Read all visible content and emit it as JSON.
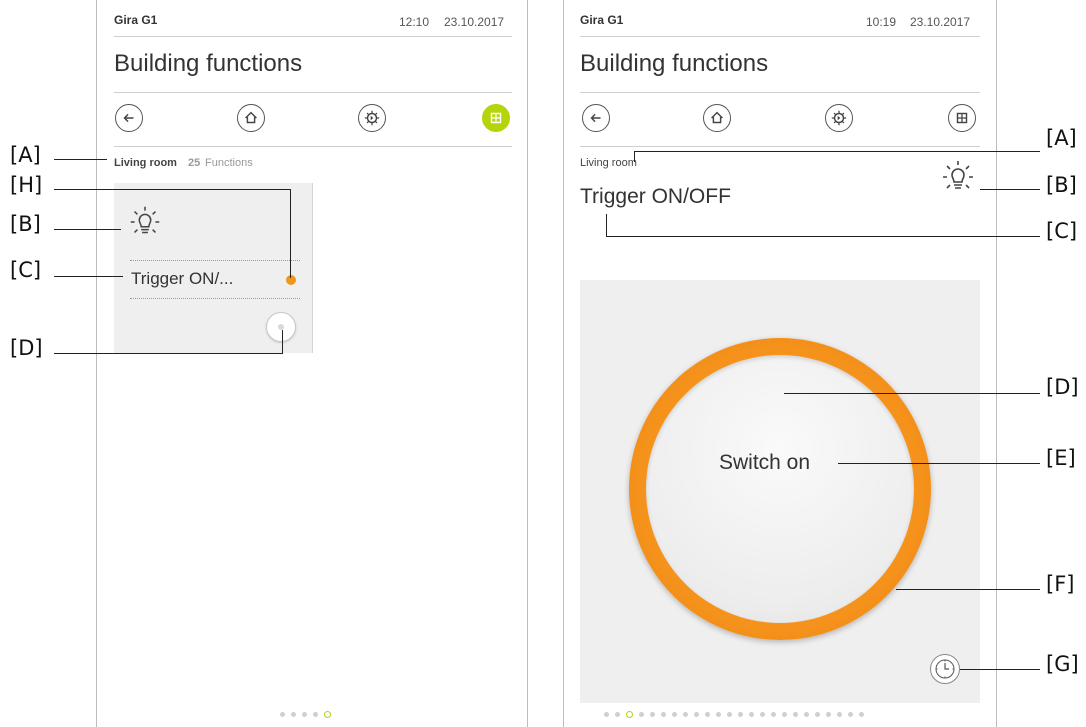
{
  "left": {
    "app_name": "Gira G1",
    "time": "12:10",
    "date": "23.10.2017",
    "page_title": "Building functions",
    "nav": [
      {
        "name": "back-icon"
      },
      {
        "name": "home-icon"
      },
      {
        "name": "gear-icon"
      },
      {
        "name": "grid-icon",
        "active": true
      }
    ],
    "room_label": "Living room",
    "function_count": "25",
    "functions_label": "Functions",
    "tile": {
      "icon": "lightbulb-icon",
      "label": "Trigger ON/...",
      "status_color": "#f0961e"
    },
    "pager": {
      "count": 5,
      "current": 5
    }
  },
  "right": {
    "app_name": "Gira G1",
    "time": "10:19",
    "date": "23.10.2017",
    "page_title": "Building functions",
    "nav": [
      {
        "name": "back-icon"
      },
      {
        "name": "home-icon"
      },
      {
        "name": "gear-icon"
      },
      {
        "name": "grid-icon",
        "active": false
      }
    ],
    "room_label": "Living room",
    "function_title": "Trigger ON/OFF",
    "switch_label": "Switch on",
    "ring_color": "#f7941d",
    "clock_icon": "clock-icon",
    "pager": {
      "count": 24,
      "current": 3
    }
  },
  "callouts_left": [
    "[A]",
    "[H]",
    "[B]",
    "[C]",
    "[D]"
  ],
  "callouts_right": [
    "[A]",
    "[B]",
    "[C]",
    "[D]",
    "[E]",
    "[F]",
    "[G]"
  ],
  "colors": {
    "accent": "#b5d40a",
    "orange": "#f7941d",
    "tile_bg": "#efefef"
  }
}
